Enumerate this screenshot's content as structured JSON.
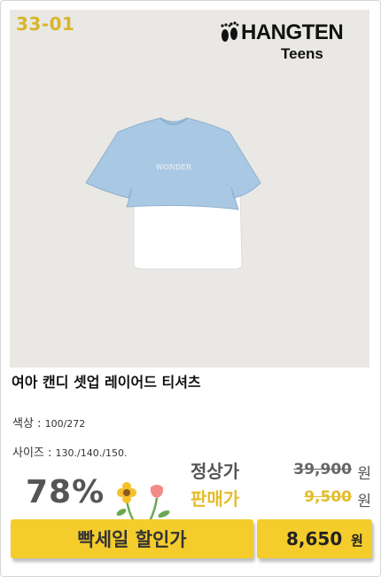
{
  "product": {
    "code": "33-01",
    "brand": "HANGTEN",
    "brand_sub": "Teens",
    "shirt_print": "WONDER",
    "title": "여아 캔디 셋업 레이어드 티셔츠",
    "color_label": "색상 :",
    "color_value": "100/272",
    "size_label": "사이즈 :",
    "size_value": "130./140./150."
  },
  "pricing": {
    "discount": "78%",
    "regular_label": "정상가",
    "regular_price": "39,900",
    "sale_label": "판매가",
    "sale_price": "9,500",
    "currency": "원",
    "banner_label": "빡세일 할인가",
    "final_price": "8,650",
    "final_currency": "원"
  },
  "colors": {
    "accent": "#f4cc2c",
    "code": "#d9b62a",
    "shirt_blue": "#a9c8e3",
    "shirt_white": "#ffffff"
  }
}
